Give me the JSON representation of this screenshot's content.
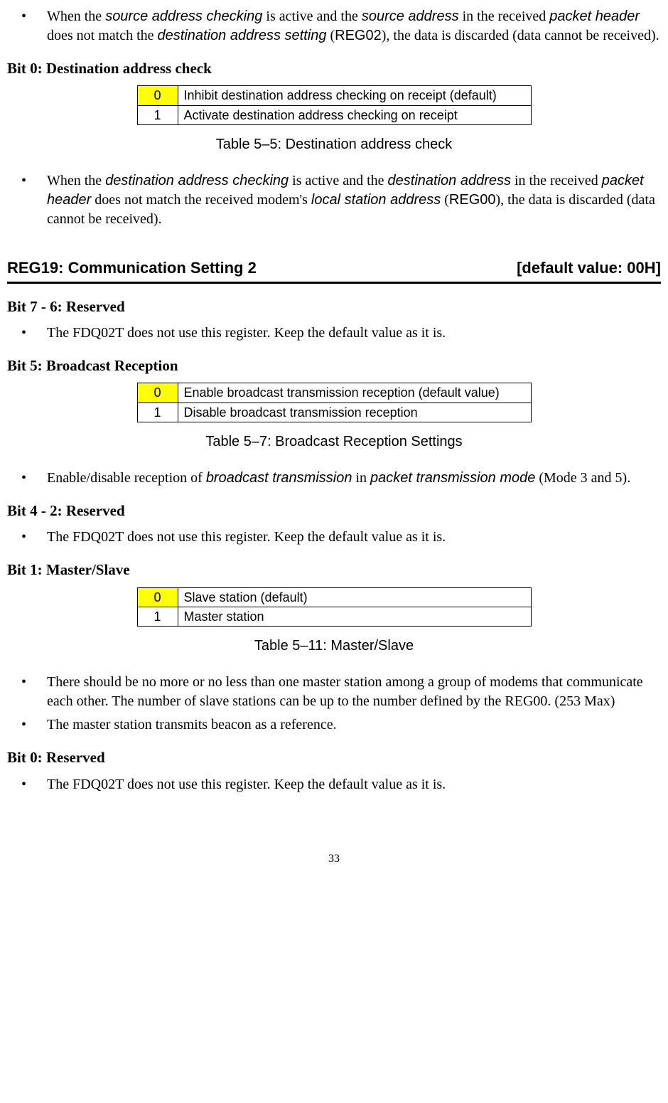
{
  "bullet1_parts": [
    {
      "text": "When the ",
      "cls": ""
    },
    {
      "text": "source address checking",
      "cls": "arial italic"
    },
    {
      "text": " is active and the ",
      "cls": ""
    },
    {
      "text": "source address",
      "cls": "arial italic"
    },
    {
      "text": " in the received ",
      "cls": ""
    },
    {
      "text": "packet header",
      "cls": "arial italic"
    },
    {
      "text": " does not match the ",
      "cls": ""
    },
    {
      "text": "destination address setting",
      "cls": "arial italic"
    },
    {
      "text": " (",
      "cls": ""
    },
    {
      "text": "REG02",
      "cls": "arial"
    },
    {
      "text": "), the data is discarded (data cannot be received).",
      "cls": ""
    }
  ],
  "bit0a_heading": "Bit 0:  Destination address check",
  "table1": {
    "rows": [
      {
        "val": "0",
        "desc": "Inhibit destination  address checking on receipt (default)",
        "highlight": true
      },
      {
        "val": "1",
        "desc": "Activate destination address checking on receipt",
        "highlight": false
      }
    ],
    "caption": "Table 5–5:  Destination address check"
  },
  "bullet2_parts": [
    {
      "text": "When the ",
      "cls": ""
    },
    {
      "text": "destination address checking",
      "cls": "arial italic"
    },
    {
      "text": " is active and the ",
      "cls": ""
    },
    {
      "text": "destination address",
      "cls": "arial italic"
    },
    {
      "text": " in the received ",
      "cls": ""
    },
    {
      "text": "packet header",
      "cls": "arial italic"
    },
    {
      "text": " does not match the received modem's ",
      "cls": ""
    },
    {
      "text": "local station address",
      "cls": "arial italic"
    },
    {
      "text": " (",
      "cls": ""
    },
    {
      "text": "REG00",
      "cls": "arial"
    },
    {
      "text": "), the data is discarded (data cannot be received).",
      "cls": ""
    }
  ],
  "reg19_left": "REG19:  Communication Setting 2",
  "reg19_right": "[default value: 00H]",
  "bit76_heading": "Bit 7 - 6:  Reserved",
  "bullet3": "The FDQ02T does not use this register. Keep the default value as it is.",
  "bit5_heading": "Bit 5:  Broadcast Reception",
  "table2": {
    "rows": [
      {
        "val": "0",
        "desc": "Enable broadcast transmission reception (default value)",
        "highlight": true
      },
      {
        "val": "1",
        "desc": "Disable broadcast transmission reception",
        "highlight": false
      }
    ],
    "caption": "Table 5–7:  Broadcast Reception Settings"
  },
  "bullet4_parts": [
    {
      "text": "Enable/disable reception of ",
      "cls": ""
    },
    {
      "text": "broadcast transmission",
      "cls": "arial italic"
    },
    {
      "text": " in ",
      "cls": ""
    },
    {
      "text": "packet transmission mode",
      "cls": "arial italic"
    },
    {
      "text": " (Mode 3 and 5).",
      "cls": ""
    }
  ],
  "bit42_heading": "Bit 4 - 2:  Reserved",
  "bullet5": "The FDQ02T does not use this register. Keep the default value as it is.",
  "bit1_heading": "Bit 1:  Master/Slave",
  "table3": {
    "rows": [
      {
        "val": "0",
        "desc": "Slave station (default)",
        "highlight": true
      },
      {
        "val": "1",
        "desc": "Master station",
        "highlight": false
      }
    ],
    "caption": "Table 5–11:  Master/Slave"
  },
  "bullet6": "There should be no more or no less than one master station among a group of modems that communicate each other. The number of slave stations can be up to the number defined by the REG00. (253 Max)",
  "bullet7": "The master station transmits beacon as a reference.",
  "bit0b_heading": "Bit 0:  Reserved",
  "bullet8": "The FDQ02T does not use this register. Keep the default value as it is.",
  "page_number": "33"
}
